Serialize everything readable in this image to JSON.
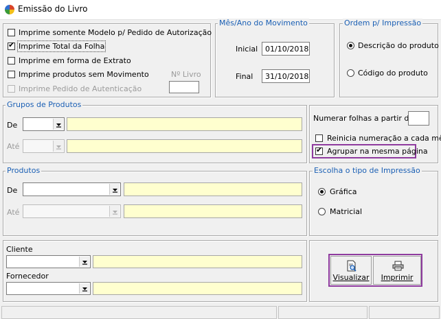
{
  "window": {
    "title": "Emissão do Livro"
  },
  "options": {
    "modelo_label": "Imprime somente Modelo p/ Pedido de Autorização",
    "modelo_checked": false,
    "total_folha_label": "Imprime Total da Folha",
    "total_folha_checked": true,
    "extrato_label": "Imprime em forma de Extrato",
    "extrato_checked": false,
    "sem_movimento_label": "Imprime produtos sem Movimento",
    "sem_movimento_checked": false,
    "autenticacao_label": "Imprime Pedido de Autenticação",
    "autenticacao_checked": false,
    "n_livro_label": "Nº Livro",
    "n_livro_value": ""
  },
  "periodo": {
    "legend": "Mês/Ano do Movimento",
    "inicial_label": "Inicial",
    "inicial_value": "01/10/2018",
    "final_label": "Final",
    "final_value": "31/10/2018"
  },
  "ordem": {
    "legend": "Ordem p/ Impressão",
    "descricao_label": "Descrição do produto",
    "codigo_label": "Código do produto",
    "selected": "descricao"
  },
  "grupos": {
    "legend": "Grupos de Produtos",
    "de_label": "De",
    "de_code": "",
    "de_desc": "",
    "ate_label": "Até",
    "ate_code": "",
    "ate_desc": ""
  },
  "numeracao": {
    "numerar_label": "Numerar folhas a partir de",
    "numerar_value": "",
    "reinicia_label": "Reinicia numeração a cada mês",
    "reinicia_checked": false,
    "agrupar_label": "Agrupar na mesma página",
    "agrupar_checked": true
  },
  "produtos": {
    "legend": "Produtos",
    "de_label": "De",
    "de_code": "",
    "de_desc": "",
    "ate_label": "Até",
    "ate_code": "",
    "ate_desc": ""
  },
  "tipo_impressao": {
    "legend": "Escolha o tipo de Impressão",
    "grafica_label": "Gráfica",
    "matricial_label": "Matricial",
    "selected": "grafica"
  },
  "partes": {
    "cliente_label": "Cliente",
    "cliente_code": "",
    "cliente_name": "",
    "fornecedor_label": "Fornecedor",
    "fornecedor_code": "",
    "fornecedor_name": ""
  },
  "actions": {
    "visualizar_label": "Visualizar",
    "imprimir_label": "Imprimir"
  },
  "colors": {
    "legend": "#1a5fb4",
    "input_yellow": "#ffffcf",
    "highlight": "#8e3a9e"
  }
}
